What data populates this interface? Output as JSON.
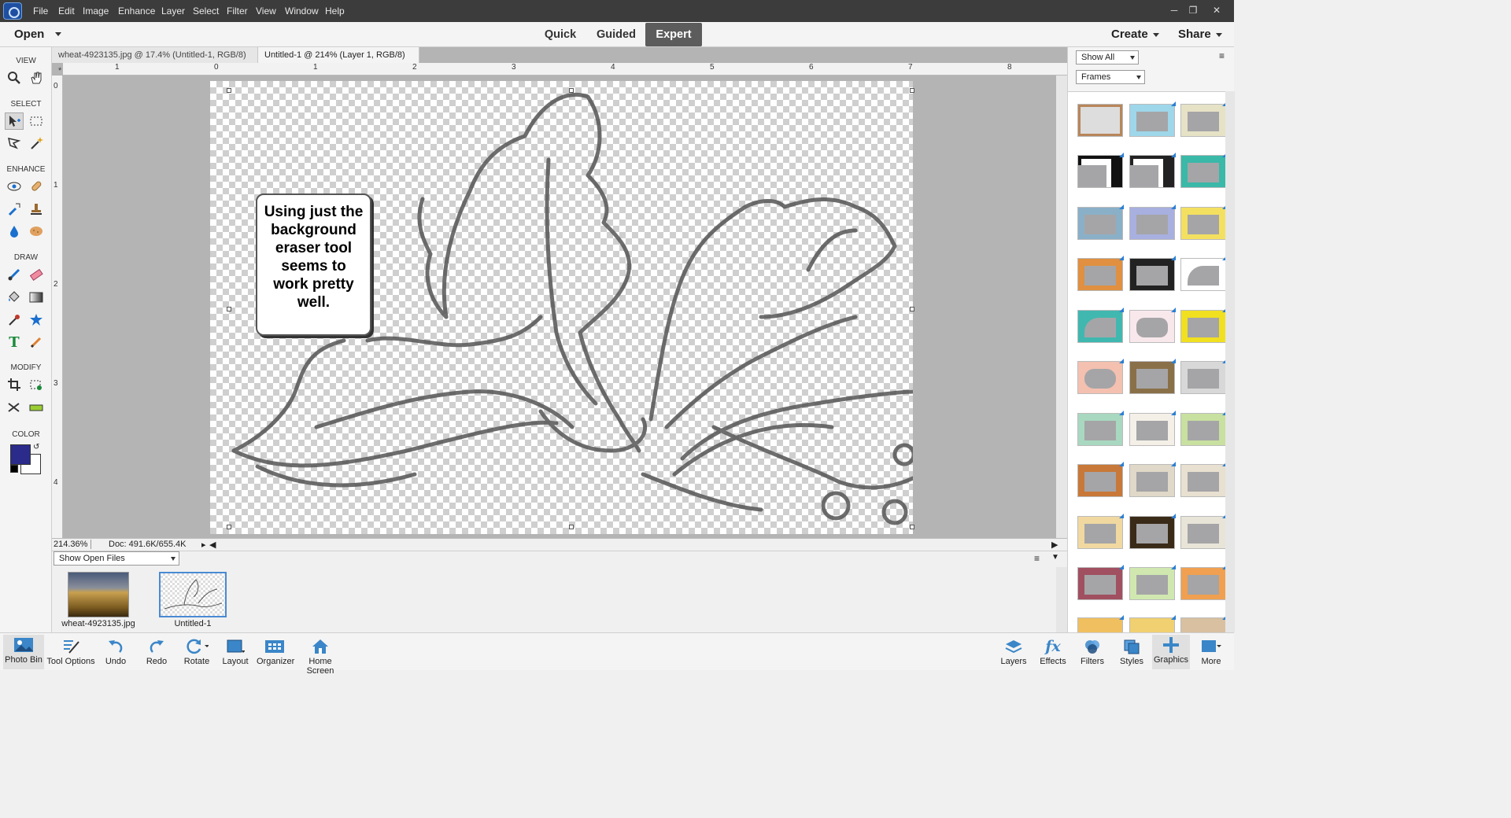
{
  "menubar": {
    "items": [
      "File",
      "Edit",
      "Image",
      "Enhance",
      "Layer",
      "Select",
      "Filter",
      "View",
      "Window",
      "Help"
    ]
  },
  "modebar": {
    "open_label": "Open",
    "modes": [
      "Quick",
      "Guided",
      "Expert"
    ],
    "active_mode": "Expert",
    "create_label": "Create",
    "share_label": "Share"
  },
  "toolbox": {
    "view": "VIEW",
    "select": "SELECT",
    "enhance": "ENHANCE",
    "draw": "DRAW",
    "modify": "MODIFY",
    "color": "COLOR",
    "fg_color": "#2b2b8c",
    "bg_color": "#ffffff"
  },
  "tabs": [
    {
      "label": "wheat-4923135.jpg @ 17.4% (Untitled-1, RGB/8) *",
      "active": false
    },
    {
      "label": "Untitled-1 @ 214% (Layer 1, RGB/8) *",
      "active": true
    }
  ],
  "rulers": {
    "h": [
      "1",
      "0",
      "1",
      "2",
      "3",
      "4",
      "5",
      "6",
      "7",
      "8"
    ],
    "v": [
      "0",
      "1",
      "2",
      "3",
      "4"
    ]
  },
  "canvas": {
    "callout_text": "Using just the background eraser tool seems to work pretty well."
  },
  "status": {
    "zoom": "214.36%",
    "doc": "Doc: 491.6K/655.4K"
  },
  "bin": {
    "show_label": "Show Open Files",
    "files": [
      "wheat-4923135.jpg",
      "Untitled-1"
    ]
  },
  "panel": {
    "show_all": "Show All",
    "category": "Frames"
  },
  "bottombar": {
    "left": [
      "Photo Bin",
      "Tool Options",
      "Undo",
      "Redo",
      "Rotate",
      "Layout",
      "Organizer",
      "Home Screen"
    ],
    "right": [
      "Layers",
      "Effects",
      "Filters",
      "Styles",
      "Graphics",
      "More"
    ]
  }
}
